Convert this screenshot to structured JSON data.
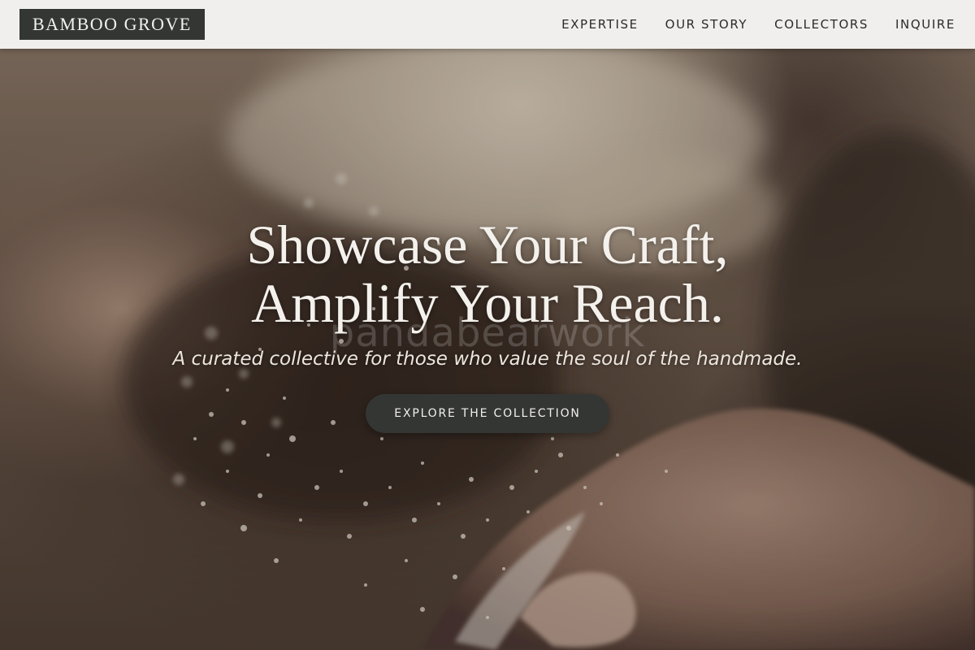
{
  "header": {
    "logo": "BAMBOO GROVE",
    "nav": [
      {
        "label": "EXPERTISE"
      },
      {
        "label": "OUR STORY"
      },
      {
        "label": "COLLECTORS"
      },
      {
        "label": "INQUIRE"
      }
    ]
  },
  "hero": {
    "title_line1": "Showcase Your Craft,",
    "title_line2": "Amplify Your Reach.",
    "subtitle": "A curated collective for those who value the soul of the handmade.",
    "cta_label": "EXPLORE THE COLLECTION",
    "watermark": "pandabearwork"
  },
  "colors": {
    "header_bg": "#f0efed",
    "logo_bg": "#343634",
    "cta_bg": "#343634",
    "title_text": "#f4f1ec"
  },
  "icons": {
    "background": "flour-dusted-hands-photo"
  }
}
